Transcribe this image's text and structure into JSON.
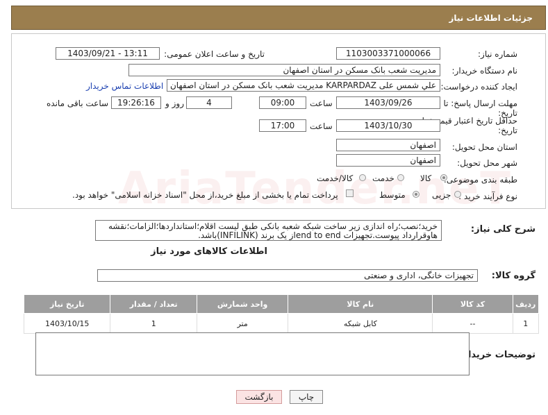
{
  "header": {
    "title": "جزئیات اطلاعات نیاز"
  },
  "watermark": "AriaTender.neT",
  "form": {
    "need_number_label": "شماره نیاز:",
    "need_number": "1103003371000066",
    "announce_label": "تاریخ و ساعت اعلان عمومی:",
    "announce_value": "1403/09/21 - 13:11",
    "buyer_label": "نام دستگاه خریدار:",
    "buyer_value": "مدیریت شعب بانک مسکن در استان اصفهان",
    "creator_label": "ایجاد کننده درخواست:",
    "creator_value": "علي شمس علی KARPARDAZ مدیریت شعب بانک مسکن در استان اصفهان",
    "contact_link": "اطلاعات تماس خریدار",
    "deadline_label_1": "مهلت ارسال پاسخ: تا",
    "deadline_label_2": "تاریخ:",
    "deadline_date": "1403/09/26",
    "time_label": "ساعت",
    "deadline_time": "09:00",
    "days_value": "4",
    "days_label": "روز و",
    "remaining_time": "19:26:16",
    "remaining_label": "ساعت باقی مانده",
    "validity_label_1": "حداقل تاریخ اعتبار قیمت: تا",
    "validity_label_2": "تاریخ:",
    "validity_date": "1403/10/30",
    "validity_time": "17:00",
    "province_label": "استان محل تحویل:",
    "province_value": "اصفهان",
    "city_label": "شهر محل تحویل:",
    "city_value": "اصفهان",
    "category_label": "طبقه بندی موضوعی:",
    "category_options": [
      "کالا",
      "خدمت",
      "کالا/خدمت"
    ],
    "process_label": "نوع فرآیند خرید :",
    "process_options": [
      "جزیی",
      "متوسط"
    ],
    "payment_note": "پرداخت تمام یا بخشی از مبلغ خرید،از محل \"اسناد خزانه اسلامی\" خواهد بود."
  },
  "description": {
    "label": "شرح کلی نیاز:",
    "text": "خرید؛نصب؛راه اندازی زیر ساخت شبکه شعبه بانکی طبق لیست اقلام؛استانداردها؛الزامات؛نقشه هاوقرارداد پیوست.تجهیزات end to endاز یک برند (INFILINK)باشد."
  },
  "goods": {
    "title": "اطلاعات کالاهای مورد نیاز",
    "group_label": "گروه کالا:",
    "group_value": "تجهیزات خانگی، اداری و صنعتی",
    "columns": [
      "ردیف",
      "کد کالا",
      "نام کالا",
      "واحد شمارش",
      "تعداد / مقدار",
      "تاریخ نیاز"
    ],
    "rows": [
      {
        "row": "1",
        "code": "--",
        "name": "کابل شبکه",
        "unit": "متر",
        "qty": "1",
        "date": "1403/10/15"
      }
    ]
  },
  "notes": {
    "label": "توضیحات خریدار:"
  },
  "buttons": {
    "print": "چاپ",
    "back": "بازگشت"
  }
}
